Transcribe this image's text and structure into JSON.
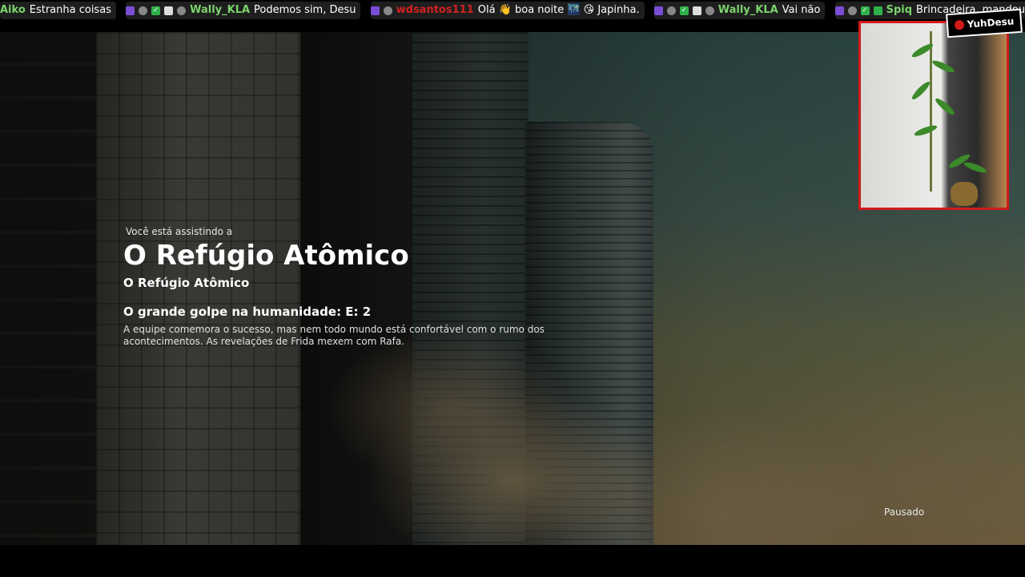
{
  "chat": {
    "messages": [
      {
        "user": "Aiko",
        "user_color": "#7bd36b",
        "text": "Estranha coisas"
      },
      {
        "user": "Wally_KLA",
        "user_color": "#7bd36b",
        "text": "Podemos sim, Desu"
      },
      {
        "user": "wdsantos111",
        "user_color": "#d42020",
        "text": "Olá 👋 boa noite 🌃 😘 Japinha."
      },
      {
        "user": "Wally_KLA",
        "user_color": "#7bd36b",
        "text": "Vai não"
      },
      {
        "user": "Spiq",
        "user_color": "#7bd36b",
        "text": "Brincadeira, mandou bem, Wally"
      }
    ]
  },
  "overlay": {
    "channel_logo": "YuhDesu",
    "accent_color": "#d01b1b"
  },
  "player": {
    "watching_label": "Você está assistindo a",
    "show_title": "O Refúgio Atômico",
    "show_subtitle": "O Refúgio Atômico",
    "episode_title": "O grande golpe na humanidade: E: 2",
    "episode_description": "A equipe comemora o sucesso, mas nem todo mundo está confortável com o rumo dos acontecimentos. As revelações de Frida mexem com Rafa.",
    "status": "Pausado"
  }
}
